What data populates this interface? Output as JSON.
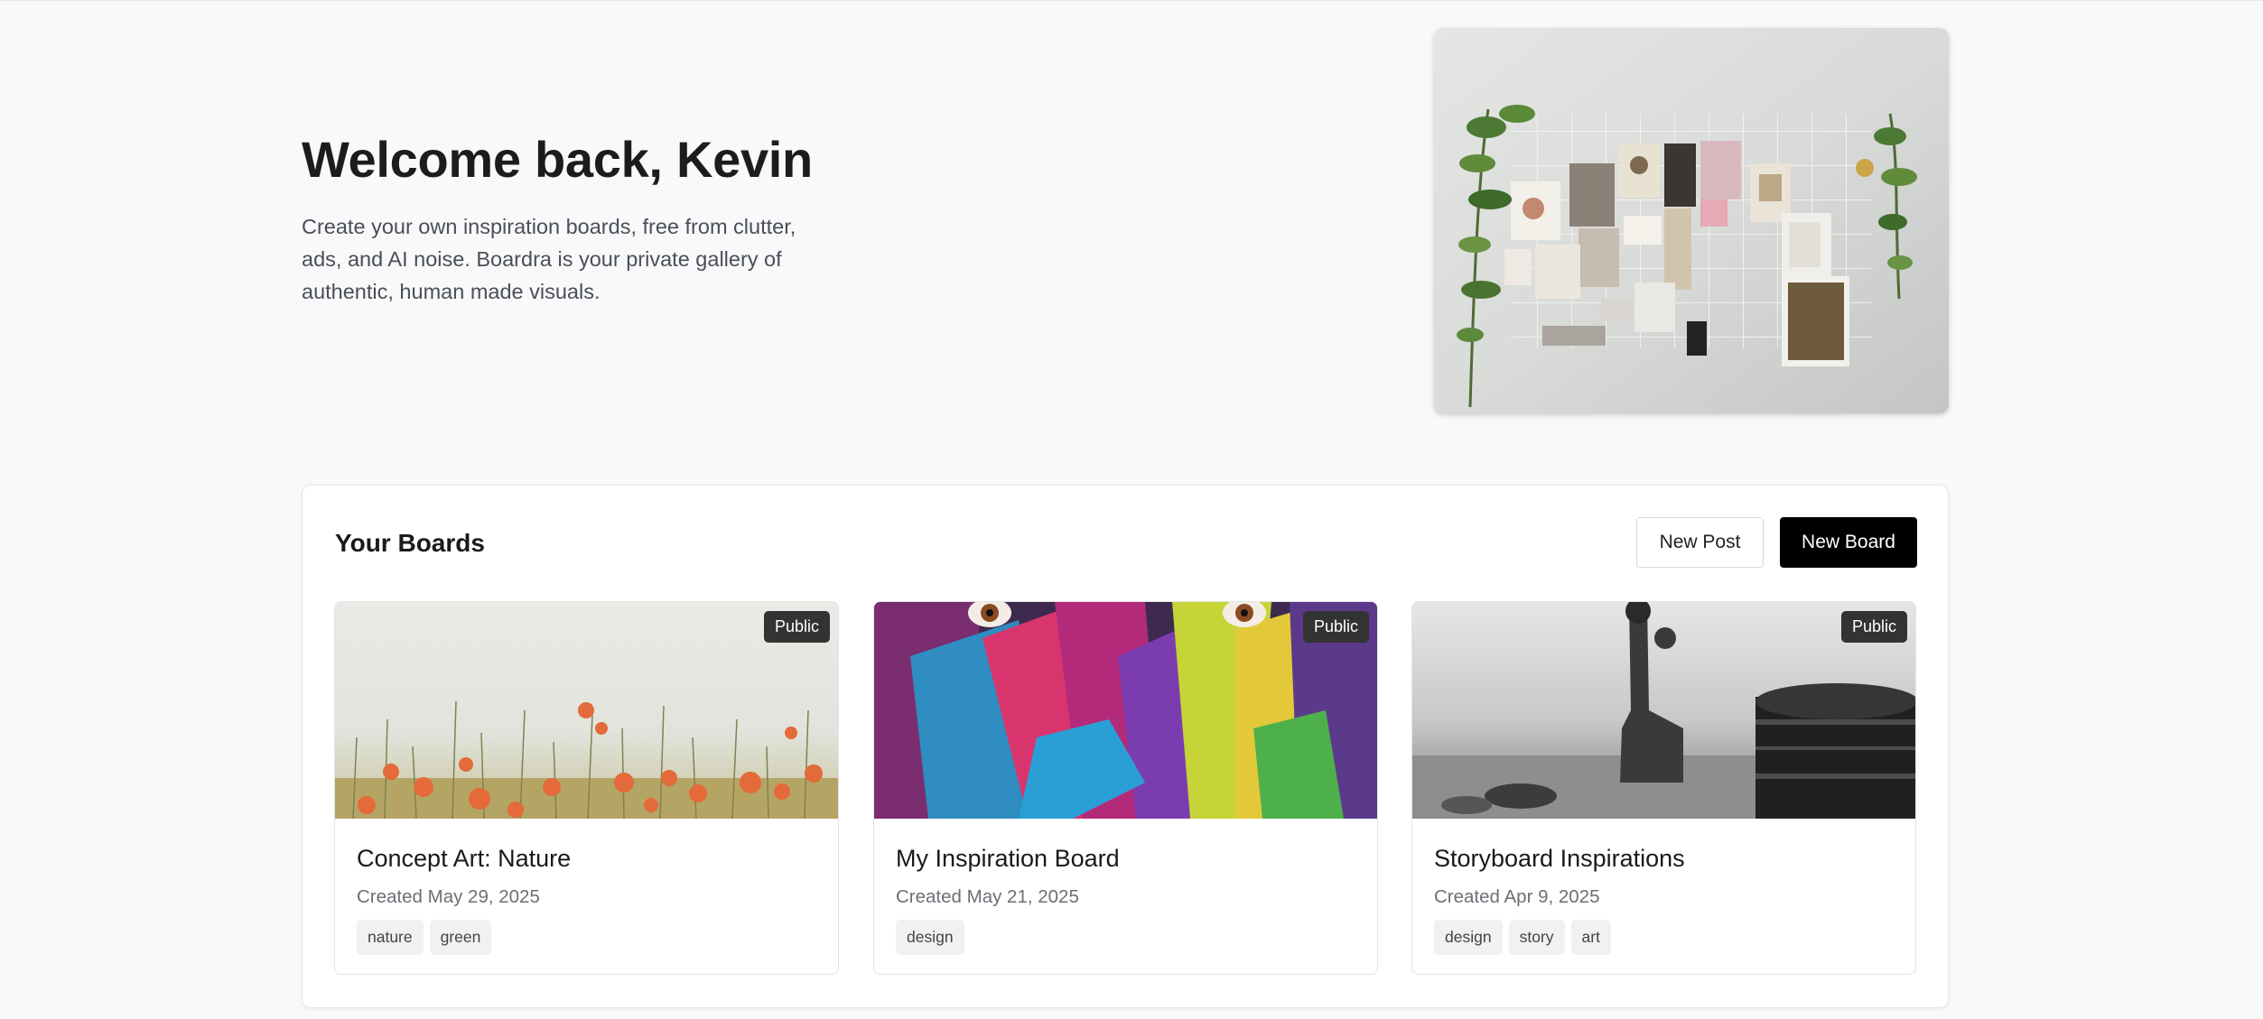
{
  "hero": {
    "title": "Welcome back, Kevin",
    "description": "Create your own inspiration boards, free from clutter, ads, and AI noise. Boardra is your private gallery of authentic, human made visuals."
  },
  "boards_section": {
    "title": "Your Boards",
    "new_post_label": "New Post",
    "new_board_label": "New Board"
  },
  "boards": [
    {
      "title": "Concept Art: Nature",
      "created": "Created May 29, 2025",
      "visibility": "Public",
      "tags": [
        "nature",
        "green"
      ]
    },
    {
      "title": "My Inspiration Board",
      "created": "Created May 21, 2025",
      "visibility": "Public",
      "tags": [
        "design"
      ]
    },
    {
      "title": "Storyboard Inspirations",
      "created": "Created Apr 9, 2025",
      "visibility": "Public",
      "tags": [
        "design",
        "story",
        "art"
      ]
    }
  ],
  "colors": {
    "page_background": "#f8f9fa",
    "primary_button": "#000000",
    "badge": "#333333",
    "tag_background": "#f0f1f3"
  }
}
